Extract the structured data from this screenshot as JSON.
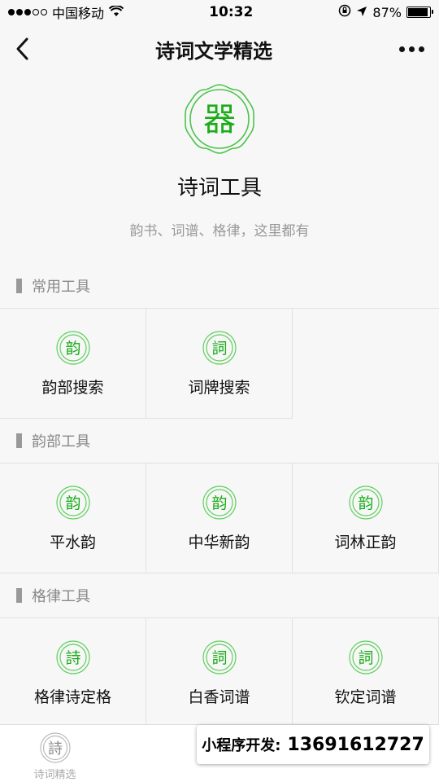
{
  "status_bar": {
    "carrier": "中国移动",
    "time": "10:32",
    "battery_pct": "87%",
    "battery_level": 0.87
  },
  "nav": {
    "title": "诗词文学精选"
  },
  "hero": {
    "logo_char": "器",
    "title": "诗词工具",
    "subtitle": "韵书、词谱、格律，这里都有"
  },
  "sections": [
    {
      "title": "常用工具",
      "items": [
        {
          "seal": "韵",
          "label": "韵部搜索"
        },
        {
          "seal": "詞",
          "label": "词牌搜索"
        }
      ]
    },
    {
      "title": "韵部工具",
      "items": [
        {
          "seal": "韵",
          "label": "平水韵"
        },
        {
          "seal": "韵",
          "label": "中华新韵"
        },
        {
          "seal": "韵",
          "label": "词林正韵"
        }
      ]
    },
    {
      "title": "格律工具",
      "items": [
        {
          "seal": "詩",
          "label": "格律诗定格"
        },
        {
          "seal": "詞",
          "label": "白香词谱"
        },
        {
          "seal": "詞",
          "label": "钦定词谱"
        }
      ]
    }
  ],
  "tabbar": {
    "tab1_icon_char": "詩",
    "tab1_label": "诗词精选"
  },
  "promo": {
    "label": "小程序开发:",
    "phone": "13691612727"
  },
  "colors": {
    "accent_green": "#1AAD19",
    "seal_border": "#5fcf5e",
    "bg": "#f7f7f7"
  }
}
